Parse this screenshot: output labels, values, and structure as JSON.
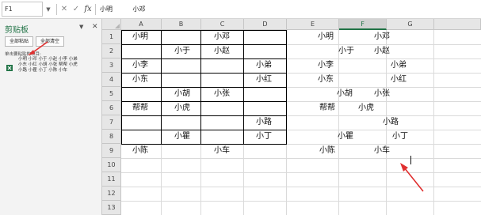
{
  "formula_bar": {
    "name_box": "F1",
    "cancel_icon": "✕",
    "enter_icon": "✓",
    "fx_label": "fx",
    "value": "小明          小邓"
  },
  "clipboard_pane": {
    "title": "剪贴板",
    "paste_all": "全部粘贴",
    "clear_all": "全部清空",
    "hint": "单击要粘贴的项目:",
    "item_lines": [
      "小明 小邓 小于 小赵 小李 小弟",
      "小东 小红 小胡 小张 帮帮 小虎",
      "小路 小瞿 小丁 小陈 小车"
    ]
  },
  "grid": {
    "columns": [
      "A",
      "B",
      "C",
      "D",
      "E",
      "F",
      "G"
    ],
    "selected_column": "F",
    "rows": [
      "1",
      "2",
      "3",
      "4",
      "5",
      "6",
      "7",
      "8",
      "9",
      "10",
      "11",
      "12",
      "13"
    ],
    "cells": {
      "a1": "小明",
      "c1": "小邓",
      "b2": "小于",
      "c2": "小赵",
      "a3": "小李",
      "d3": "小弟",
      "a4": "小东",
      "d4": "小红",
      "b5": "小胡",
      "c5": "小张",
      "a6": "帮帮",
      "b6": "小虎",
      "d7": "小路",
      "b8": "小瞿",
      "d8": "小丁",
      "a9": "小陈",
      "c9": "小车"
    },
    "pasted": {
      "l1a": "小明",
      "l1b": "小邓",
      "l2a": "小于",
      "l2b": "小赵",
      "l3a": "小李",
      "l3b": "小弟",
      "l4a": "小东",
      "l4b": "小红",
      "l5a": "小胡",
      "l5b": "小张",
      "l6a": "帮帮",
      "l6b": "小虎",
      "l7a": "小路",
      "l8a": "小瞿",
      "l8b": "小丁",
      "l9a": "小陈",
      "l9b": "小车"
    }
  },
  "colors": {
    "accent_green": "#217346",
    "annotation_red": "#e03030"
  },
  "icons": {
    "pane_close": "close-icon",
    "pane_options": "chevron-down-icon",
    "clip_item": "excel-file-icon"
  }
}
